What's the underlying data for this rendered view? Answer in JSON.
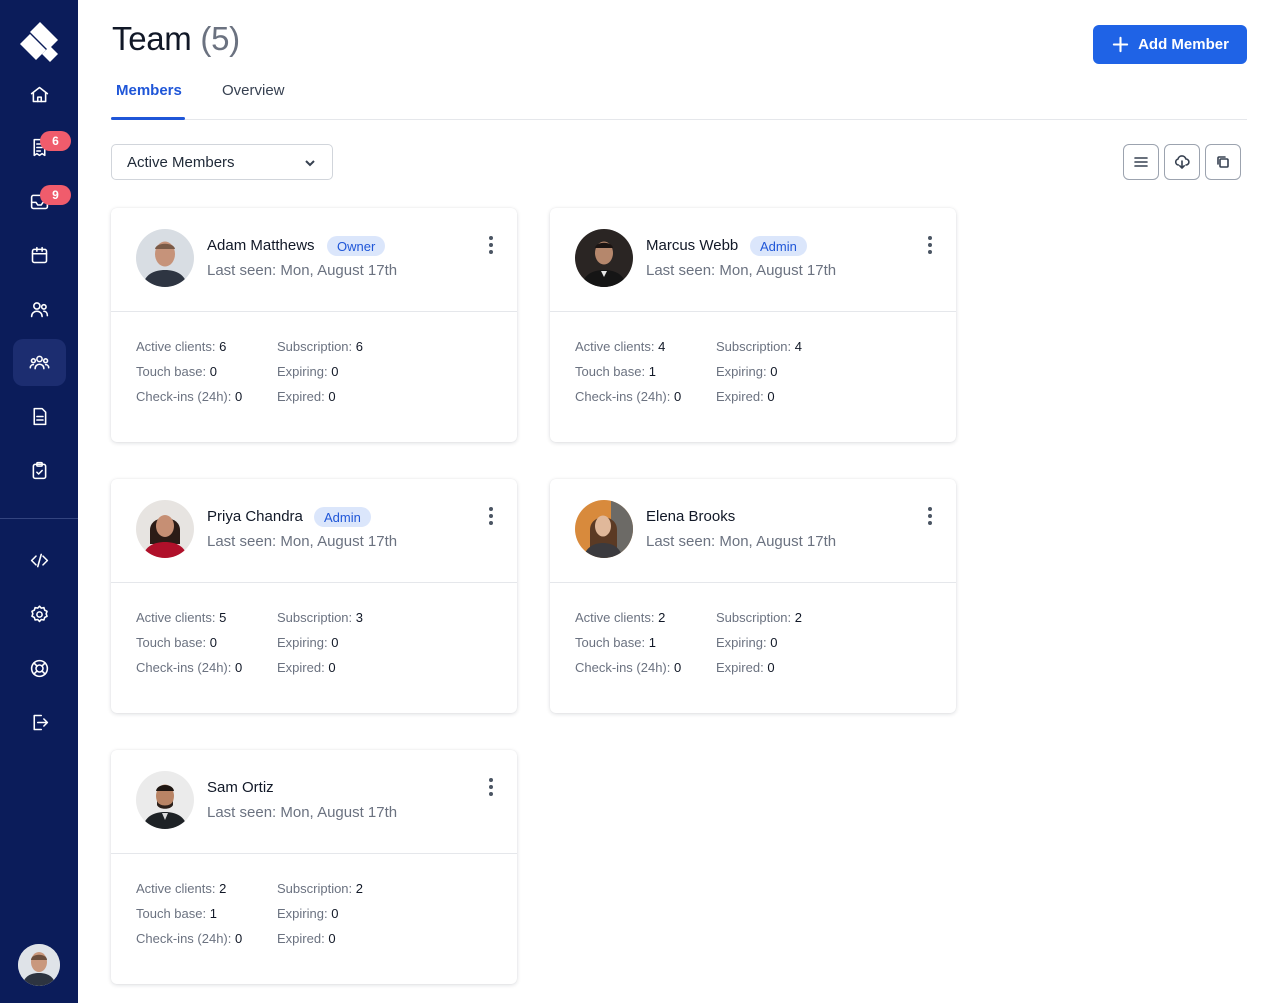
{
  "sidebar": {
    "logo_icon": "brand-diamond-logo",
    "items": [
      {
        "icon": "home-icon",
        "badge": null
      },
      {
        "icon": "receipt-icon",
        "badge": "6"
      },
      {
        "icon": "inbox-icon",
        "badge": "9"
      },
      {
        "icon": "calendar-icon",
        "badge": null
      },
      {
        "icon": "users-icon",
        "badge": null
      },
      {
        "icon": "team-icon",
        "badge": null,
        "active": true
      },
      {
        "icon": "document-icon",
        "badge": null
      },
      {
        "icon": "clipboard-check-icon",
        "badge": null
      },
      {
        "icon": "code-icon",
        "badge": null
      },
      {
        "icon": "settings-gear-icon",
        "badge": null
      },
      {
        "icon": "help-lifebuoy-icon",
        "badge": null
      },
      {
        "icon": "logout-icon",
        "badge": null
      }
    ]
  },
  "header": {
    "title": "Team",
    "count": "(5)",
    "add_button": "Add Member"
  },
  "tabs": [
    {
      "label": "Members",
      "active": true
    },
    {
      "label": "Overview",
      "active": false
    }
  ],
  "filter": {
    "selected": "Active Members"
  },
  "toolbar": [
    "list-view-icon",
    "cloud-download-icon",
    "copy-icon"
  ],
  "stat_labels": {
    "active_clients": "Active clients:",
    "touch_base": "Touch base:",
    "checkins": "Check-ins (24h):",
    "subscription": "Subscription:",
    "expiring": "Expiring:",
    "expired": "Expired:"
  },
  "members": [
    {
      "name": "Adam Matthews",
      "role": "Owner",
      "last_seen": "Last seen: Mon, August 17th",
      "active_clients": "6",
      "touch_base": "0",
      "checkins": "0",
      "subscription": "6",
      "expiring": "0",
      "expired": "0"
    },
    {
      "name": "Marcus Webb",
      "role": "Admin",
      "last_seen": "Last seen: Mon, August 17th",
      "active_clients": "4",
      "touch_base": "1",
      "checkins": "0",
      "subscription": "4",
      "expiring": "0",
      "expired": "0"
    },
    {
      "name": "Priya Chandra",
      "role": "Admin",
      "last_seen": "Last seen: Mon, August 17th",
      "active_clients": "5",
      "touch_base": "0",
      "checkins": "0",
      "subscription": "3",
      "expiring": "0",
      "expired": "0"
    },
    {
      "name": "Elena Brooks",
      "role": "",
      "last_seen": "Last seen: Mon, August 17th",
      "active_clients": "2",
      "touch_base": "1",
      "checkins": "0",
      "subscription": "2",
      "expiring": "0",
      "expired": "0"
    },
    {
      "name": "Sam Ortiz",
      "role": "",
      "last_seen": "Last seen: Mon, August 17th",
      "active_clients": "2",
      "touch_base": "1",
      "checkins": "0",
      "subscription": "2",
      "expiring": "0",
      "expired": "0"
    }
  ],
  "colors": {
    "sidebar_bg": "#0b1c5a",
    "accent": "#1f63e6",
    "badge_red": "#f05c6c",
    "role_badge_bg": "#dbe6fb"
  }
}
